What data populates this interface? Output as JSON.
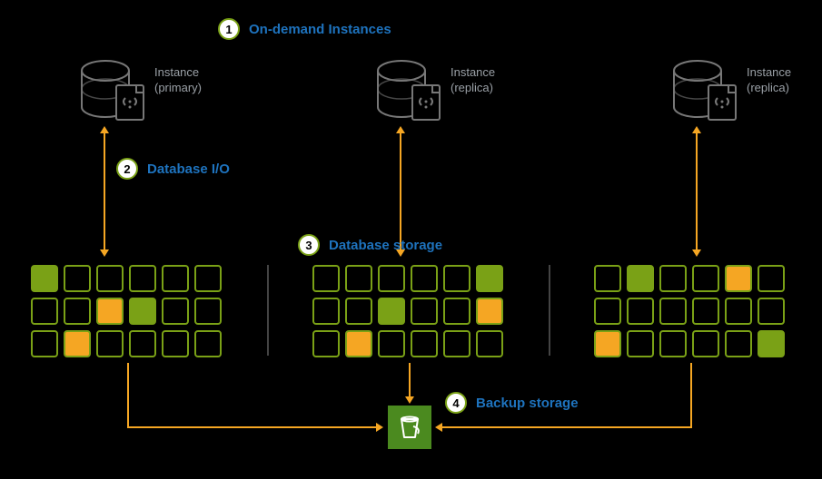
{
  "callouts": {
    "c1": {
      "num": "1",
      "label": "On-demand Instances"
    },
    "c2": {
      "num": "2",
      "label": "Database I/O"
    },
    "c3": {
      "num": "3",
      "label": "Database storage"
    },
    "c4": {
      "num": "4",
      "label": "Backup storage"
    }
  },
  "instances": [
    {
      "name": "Instance",
      "role": "(primary)"
    },
    {
      "name": "Instance",
      "role": "(replica)"
    },
    {
      "name": "Instance",
      "role": "(replica)"
    }
  ],
  "storage_grids": [
    {
      "rows": [
        [
          "g",
          "",
          "",
          "",
          "",
          ""
        ],
        [
          "",
          "",
          "y",
          "g",
          "",
          ""
        ],
        [
          "",
          "y",
          "",
          "",
          "",
          ""
        ]
      ]
    },
    {
      "rows": [
        [
          "",
          "",
          "",
          "",
          "",
          "g"
        ],
        [
          "",
          "",
          "g",
          "",
          "",
          "y"
        ],
        [
          "",
          "y",
          "",
          "",
          "",
          ""
        ]
      ]
    },
    {
      "rows": [
        [
          "",
          "g",
          "",
          "",
          "y",
          ""
        ],
        [
          "",
          "",
          "",
          "",
          "",
          ""
        ],
        [
          "y",
          "",
          "",
          "",
          "",
          "g"
        ]
      ]
    }
  ],
  "colors": {
    "accent_green": "#7aa116",
    "accent_orange": "#f5a623",
    "label_blue": "#1e73be",
    "bucket_green": "#4b8a1f"
  }
}
